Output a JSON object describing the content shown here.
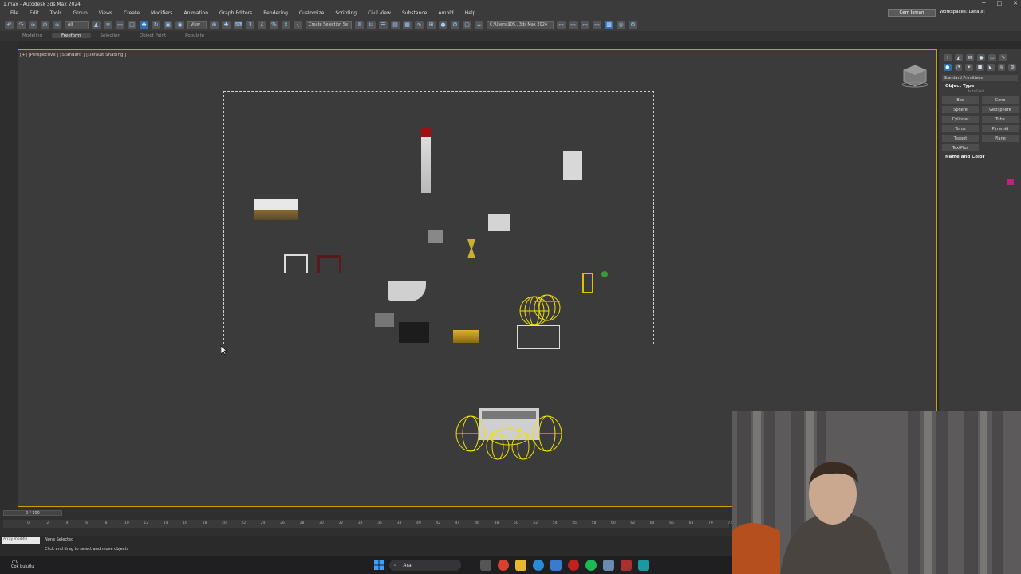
{
  "window": {
    "title": "1.max - Autodesk 3ds Max 2024",
    "controls": [
      "─",
      "□",
      "✕"
    ]
  },
  "menu": {
    "items": [
      "File",
      "Edit",
      "Tools",
      "Group",
      "Views",
      "Create",
      "Modifiers",
      "Animation",
      "Graph Editors",
      "Rendering",
      "Customize",
      "Scripting",
      "Civil View",
      "Substance",
      "Arnold",
      "Help"
    ],
    "user": "Cem Isman",
    "workspaces_label": "Workspaces:",
    "workspace_value": "Default"
  },
  "toolbar": {
    "filter_value": "All",
    "view_value": "View",
    "create_selection_set": "Create Selection Se",
    "project_path": "C:\\Users\\905...3ds Max 2024"
  },
  "ribbon": {
    "tabs": [
      "Modeling",
      "Freeform",
      "Selection",
      "Object Paint",
      "Populate"
    ],
    "active_tab": "Freeform"
  },
  "viewport": {
    "label": "[+] [Perspective ] [Standard ] [Default Shading ]"
  },
  "command_panel": {
    "dropdown": "Standard Primitives",
    "object_type_title": "Object Type",
    "autogrid": "AutoGrid",
    "buttons": [
      "Box",
      "Cone",
      "Sphere",
      "GeoSphere",
      "Cylinder",
      "Tube",
      "Torus",
      "Pyramid",
      "Teapot",
      "Plane",
      "TextPlus"
    ],
    "name_color_title": "Name and Color",
    "object_color": "#c02080"
  },
  "timeline": {
    "slider": "0 / 100",
    "ticks": [
      "0",
      "2",
      "4",
      "6",
      "8",
      "10",
      "12",
      "14",
      "16",
      "18",
      "20",
      "22",
      "24",
      "26",
      "28",
      "30",
      "32",
      "34",
      "36",
      "38",
      "40",
      "42",
      "44",
      "46",
      "48",
      "50",
      "52",
      "54",
      "56",
      "58",
      "60",
      "62",
      "64",
      "66",
      "68",
      "70",
      "72"
    ]
  },
  "status": {
    "maxscript": "Array modifie",
    "line1": "None Selected",
    "line2": "Click and drag to select and move objects"
  },
  "taskbar": {
    "weather_temp": "7°C",
    "weather_text": "Çok bulutlu",
    "search_placeholder": "Ara"
  }
}
